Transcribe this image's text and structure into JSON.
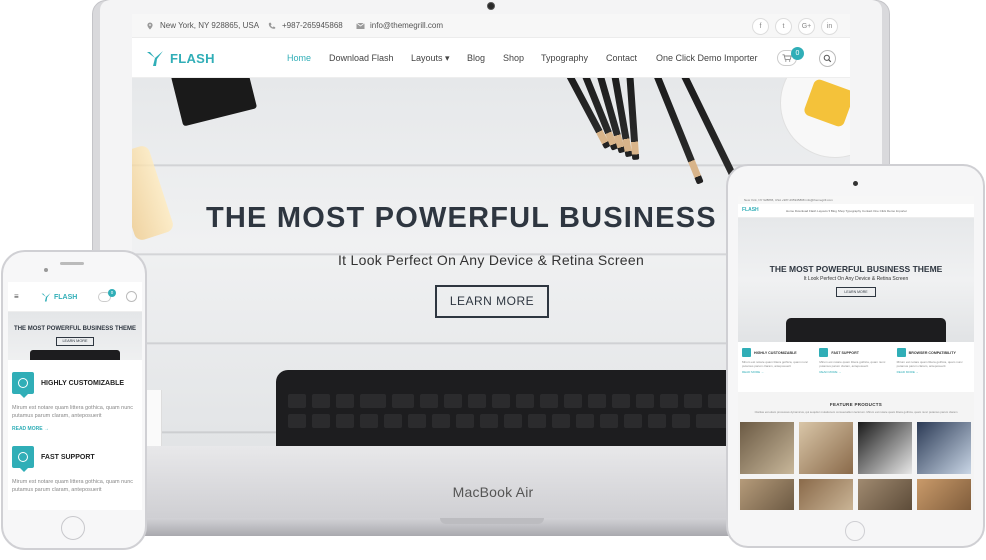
{
  "laptop": {
    "brand_label": "MacBook Air",
    "topbar": {
      "location": "New York, NY 928865, USA",
      "phone": "+987-265945868",
      "email": "info@themegrill.com",
      "social": [
        "f",
        "t",
        "G+",
        "in"
      ]
    },
    "header": {
      "logo_text": "FLASH",
      "nav": [
        "Home",
        "Download Flash",
        "Layouts ▾",
        "Blog",
        "Shop",
        "Typography",
        "Contact",
        "One Click Demo Importer"
      ],
      "active_nav": "Home",
      "cart_count": "0"
    },
    "hero": {
      "title": "THE MOST POWERFUL BUSINESS THEME",
      "subtitle": "It Look Perfect On Any Device & Retina Screen",
      "button": "LEARN MORE"
    }
  },
  "tablet": {
    "topbar_text": "New York, NY 928865, USA   +987-265945868   info@themegrill.com",
    "logo_text": "FLASH",
    "nav_text": "Home  Download Flash  Layouts ▾  Blog  Shop  Typography  Contact  One Click Demo Importer",
    "hero": {
      "title": "THE MOST POWERFUL BUSINESS THEME",
      "subtitle": "It Look Perfect On Any Device & Retina Screen",
      "button": "LEARN MORE"
    },
    "features": [
      {
        "title": "HIGHLY CUSTOMIZABLE",
        "text": "Mirum est notare quam littera gothica, quam nunc putamus parum claram, anteposuerit",
        "more": "READ MORE →"
      },
      {
        "title": "FAST SUPPORT",
        "text": "Mirum est notare quam littera gothica, quam nunc putamus parum claram, anteposuerit",
        "more": "READ MORE →"
      },
      {
        "title": "BROWSER COMPATIBILITY",
        "text": "Mirum est notare quam littera gothica, quam nunc putamus parum claram, anteposuerit",
        "more": "READ MORE →"
      }
    ],
    "products_title": "FEATURE PRODUCTS",
    "products_text": "Claritas est etiam processus dynamicus, qui sequitur mutationem consuetudium lectorum. Mirum est notare quam littera gothica, quam nunc putamus parum claram"
  },
  "phone": {
    "menu_icon": "≡",
    "logo_text": "FLASH",
    "cart_count": "0",
    "hero": {
      "title": "THE MOST POWERFUL BUSINESS THEME",
      "button": "LEARN MORE"
    },
    "features": [
      {
        "title": "HIGHLY CUSTOMIZABLE",
        "text": "Mirum est notare quam littera gothica, quam nunc putamus parum claram, anteposuerit",
        "more": "READ MORE →"
      },
      {
        "title": "FAST SUPPORT",
        "text": "Mirum est notare quam littera gothica, quam nunc putamus parum claram, anteposuerit"
      }
    ]
  },
  "colors": {
    "accent": "#30aeb7",
    "heading": "#2e3640"
  },
  "icons": [
    "map-pin-icon",
    "phone-icon",
    "mail-icon",
    "facebook-icon",
    "twitter-icon",
    "google-plus-icon",
    "linkedin-icon",
    "cart-icon",
    "search-icon",
    "menu-icon",
    "gear-icon",
    "lifebuoy-icon"
  ]
}
